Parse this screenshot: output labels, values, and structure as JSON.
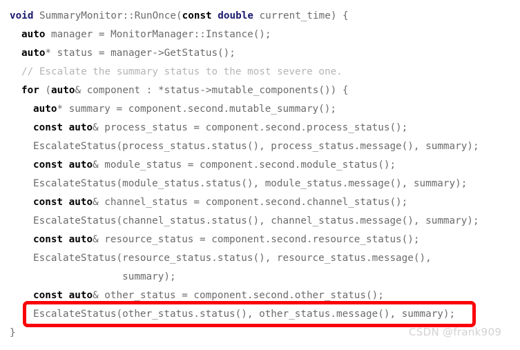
{
  "editor": {
    "language": "cpp",
    "background_color": "#ffffff",
    "plain_text_color": "#6b6b6b",
    "keyword_color": "#000000",
    "type_color": "#1a1a6e",
    "comment_color": "#b5b5b5",
    "lines": [
      {
        "indent": 0,
        "tokens": [
          {
            "t": "void",
            "k": "type"
          },
          {
            "t": " SummaryMonitor::RunOnce(",
            "k": "plain"
          },
          {
            "t": "const",
            "k": "kw"
          },
          {
            "t": " ",
            "k": "plain"
          },
          {
            "t": "double",
            "k": "type"
          },
          {
            "t": " current_time) {",
            "k": "plain"
          }
        ]
      },
      {
        "indent": 1,
        "tokens": [
          {
            "t": "auto",
            "k": "kw"
          },
          {
            "t": " manager = MonitorManager::Instance();",
            "k": "plain"
          }
        ]
      },
      {
        "indent": 1,
        "tokens": [
          {
            "t": "auto",
            "k": "kw"
          },
          {
            "t": "* status = manager->GetStatus();",
            "k": "plain"
          }
        ]
      },
      {
        "indent": 1,
        "tokens": [
          {
            "t": "// Escalate the summary status to the most severe one.",
            "k": "comment"
          }
        ]
      },
      {
        "indent": 1,
        "tokens": [
          {
            "t": "for",
            "k": "kw"
          },
          {
            "t": " (",
            "k": "plain"
          },
          {
            "t": "auto",
            "k": "kw"
          },
          {
            "t": "& component : *status->mutable_components()) {",
            "k": "plain"
          }
        ]
      },
      {
        "indent": 2,
        "tokens": [
          {
            "t": "auto",
            "k": "kw"
          },
          {
            "t": "* summary = component.second.mutable_summary();",
            "k": "plain"
          }
        ]
      },
      {
        "indent": 2,
        "tokens": [
          {
            "t": "const auto",
            "k": "kw"
          },
          {
            "t": "& process_status = component.second.process_status();",
            "k": "plain"
          }
        ]
      },
      {
        "indent": 2,
        "tokens": [
          {
            "t": "EscalateStatus(process_status.status(), process_status.message(), summary);",
            "k": "plain"
          }
        ]
      },
      {
        "indent": 2,
        "tokens": [
          {
            "t": "const auto",
            "k": "kw"
          },
          {
            "t": "& module_status = component.second.module_status();",
            "k": "plain"
          }
        ]
      },
      {
        "indent": 2,
        "tokens": [
          {
            "t": "EscalateStatus(module_status.status(), module_status.message(), summary);",
            "k": "plain"
          }
        ]
      },
      {
        "indent": 2,
        "tokens": [
          {
            "t": "const auto",
            "k": "kw"
          },
          {
            "t": "& channel_status = component.second.channel_status();",
            "k": "plain"
          }
        ]
      },
      {
        "indent": 2,
        "tokens": [
          {
            "t": "EscalateStatus(channel_status.status(), channel_status.message(), summary);",
            "k": "plain"
          }
        ]
      },
      {
        "indent": 2,
        "tokens": [
          {
            "t": "const auto",
            "k": "kw"
          },
          {
            "t": "& resource_status = component.second.resource_status();",
            "k": "plain"
          }
        ]
      },
      {
        "indent": 2,
        "tokens": [
          {
            "t": "EscalateStatus(resource_status.status(), resource_status.message(),",
            "k": "plain"
          }
        ]
      },
      {
        "indent": 2,
        "extra_spaces": 15,
        "tokens": [
          {
            "t": "summary);",
            "k": "plain"
          }
        ]
      },
      {
        "indent": 2,
        "tokens": [
          {
            "t": "const auto",
            "k": "kw"
          },
          {
            "t": "& other_status = component.second.other_status();",
            "k": "plain"
          }
        ]
      },
      {
        "indent": 2,
        "highlighted": true,
        "tokens": [
          {
            "t": "EscalateStatus(other_status.status(), other_status.message(), summary);",
            "k": "plain"
          }
        ]
      },
      {
        "indent": 0,
        "tokens": [
          {
            "t": "}",
            "k": "brace"
          }
        ]
      }
    ]
  },
  "annotation": {
    "highlight_box": {
      "color": "#fb0007",
      "border_width_px": 5,
      "target_line_index": 16
    }
  },
  "watermark": {
    "text": "CSDN @frank909",
    "color": "#d2d2d2"
  }
}
